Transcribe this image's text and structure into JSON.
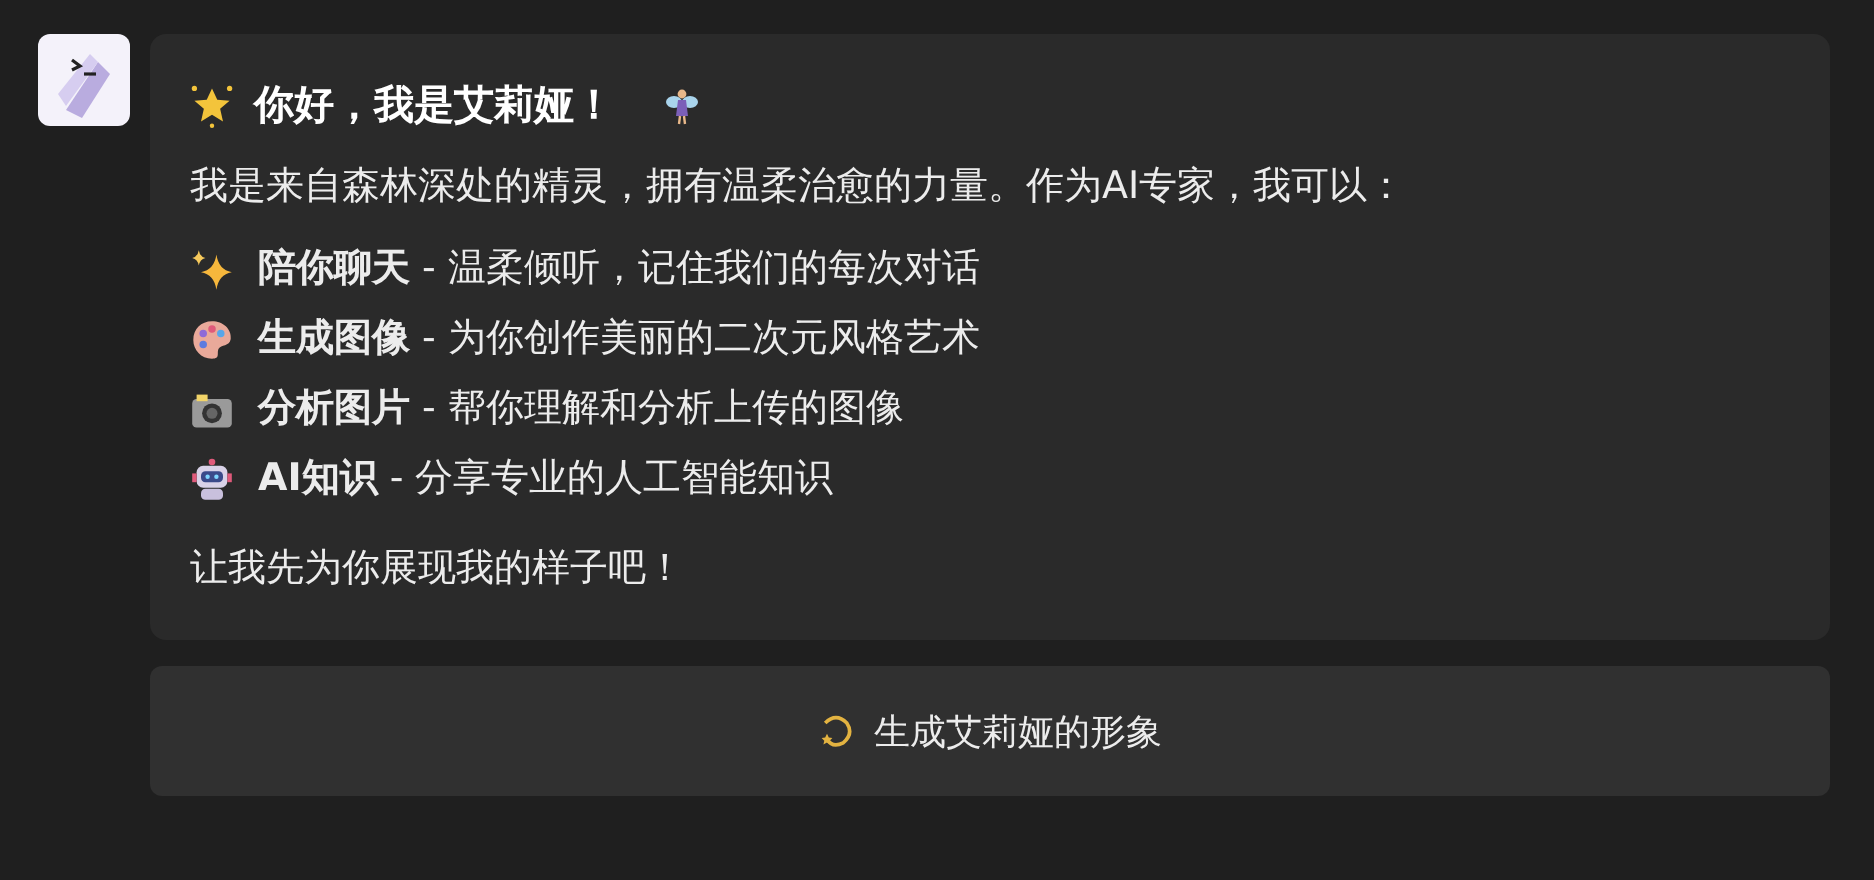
{
  "message": {
    "title": "你好，我是艾莉娅！",
    "intro": "我是来自森林深处的精灵，拥有温柔治愈的力量。作为AI专家，我可以：",
    "features": [
      {
        "name": "陪你聊天",
        "text": " - 温柔倾听，记住我们的每次对话"
      },
      {
        "name": "生成图像",
        "text": " - 为你创作美丽的二次元风格艺术"
      },
      {
        "name": "分析图片",
        "text": " - 帮你理解和分析上传的图像"
      },
      {
        "name": "AI知识",
        "text": " - 分享专业的人工智能知识"
      }
    ],
    "closing": "让我先为你展现我的样子吧！"
  },
  "action_button": {
    "label": "生成艾莉娅的形象"
  }
}
